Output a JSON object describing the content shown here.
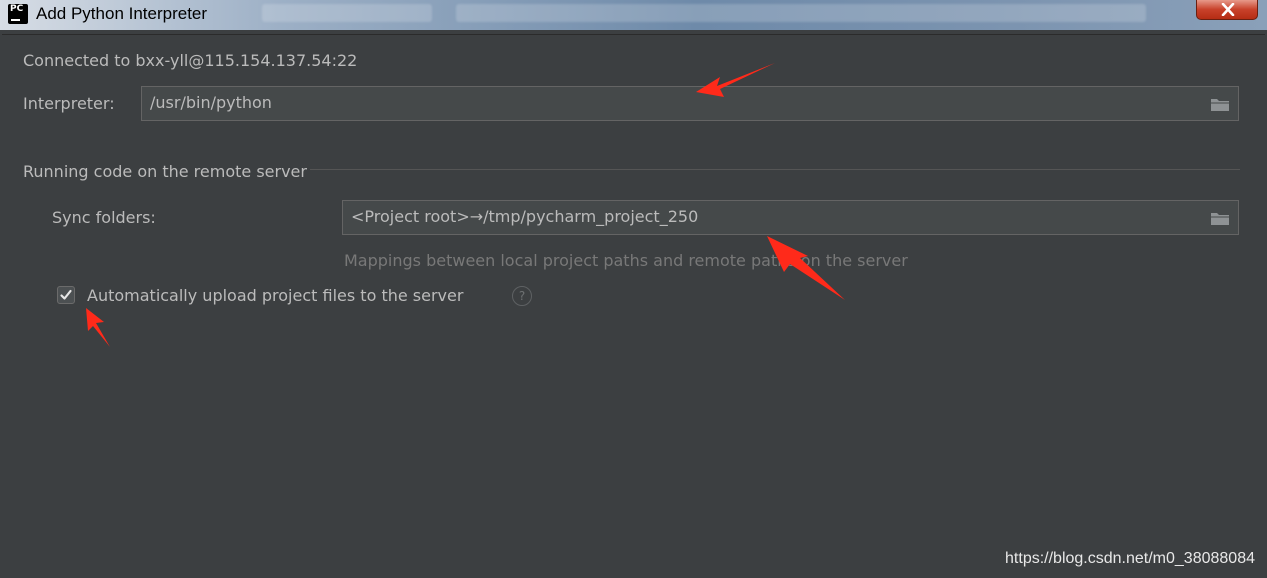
{
  "window": {
    "title": "Add Python Interpreter",
    "app_icon_text": "PC"
  },
  "dialog": {
    "connected_text": "Connected to bxx-yll@115.154.137.54:22",
    "interpreter": {
      "label": "Interpreter:",
      "value": "/usr/bin/python"
    },
    "remote_section": {
      "title": "Running code on the remote server",
      "sync_folders": {
        "label": "Sync folders:",
        "value": "<Project root>→/tmp/pycharm_project_250",
        "hint": "Mappings between local project paths and remote paths on the server"
      },
      "auto_upload": {
        "label": "Automatically upload project files to the server",
        "checked": true
      }
    }
  },
  "watermark": "https://blog.csdn.net/m0_38088084",
  "colors": {
    "background": "#3c3f41",
    "text": "#bbbbbb",
    "field_background": "#45494a",
    "annotation_arrow": "#ff2a1a"
  },
  "icons": {
    "browse": "folder-icon",
    "help": "question-mark-icon",
    "close": "close-icon"
  }
}
